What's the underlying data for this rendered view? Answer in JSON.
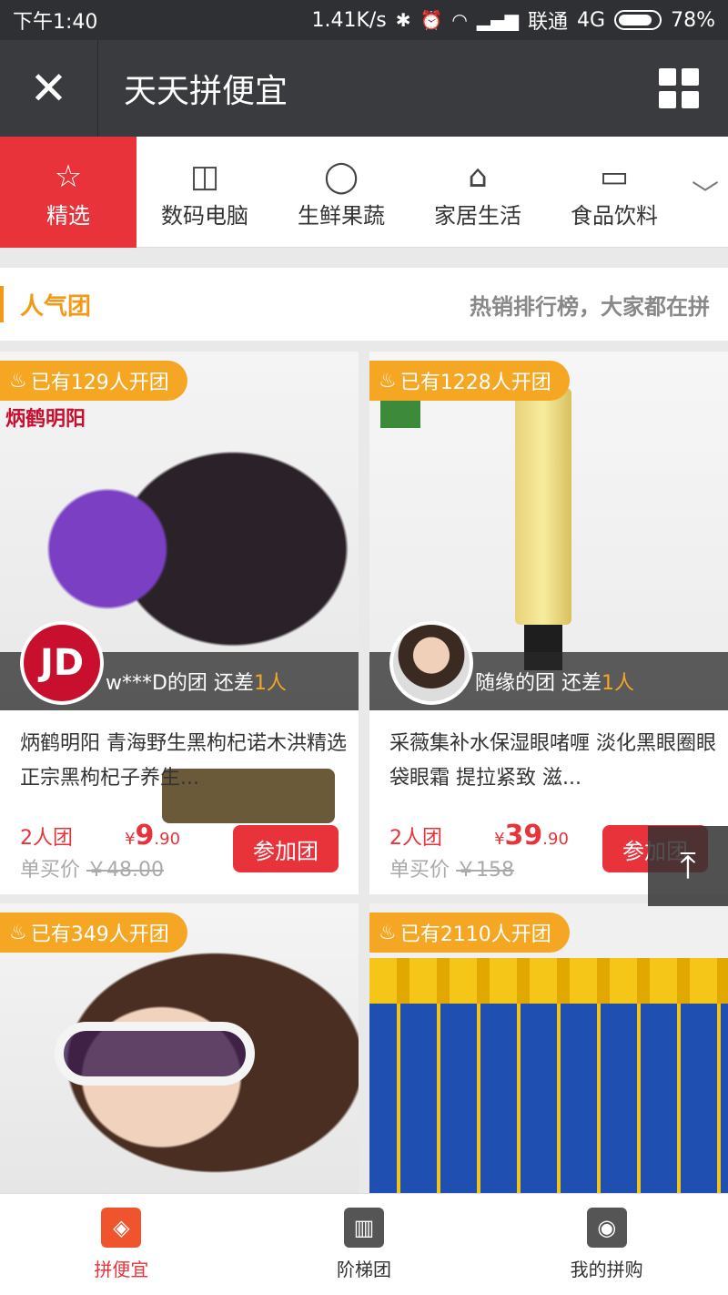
{
  "status": {
    "time": "下午1:40",
    "speed": "1.41K/s",
    "carrier": "联通",
    "network": "4G",
    "battery": "78%"
  },
  "nav": {
    "title": "天天拼便宜",
    "close_icon": "close-icon",
    "grid_icon": "grid-icon"
  },
  "categories": [
    {
      "label": "精选",
      "icon": "star-icon",
      "active": true
    },
    {
      "label": "数码电脑",
      "icon": "camera-icon"
    },
    {
      "label": "生鲜果蔬",
      "icon": "apple-icon"
    },
    {
      "label": "家居生活",
      "icon": "sofa-icon"
    },
    {
      "label": "食品饮料",
      "icon": "box-icon"
    }
  ],
  "section": {
    "title": "人气团",
    "subtitle": "热销排行榜，大家都在拼"
  },
  "products": [
    {
      "badge": "已有129人开团",
      "image_text": "炳鹤明阳",
      "avatar_text": "JD",
      "group_text": "w***D的团 还差",
      "need": "1人",
      "name": "炳鹤明阳 青海野生黑枸杞诺木洪精选正宗黑枸杞子养生...",
      "group_size": "2人团",
      "price_symbol": "¥",
      "price_int": "9",
      "price_dec": ".90",
      "solo_label": "单买价",
      "solo_price": "￥48.00",
      "join_label": "参加团"
    },
    {
      "badge": "已有1228人开团",
      "group_text": "随缘的团 还差",
      "need": "1人",
      "name": "采薇集补水保湿眼啫喱 淡化黑眼圈眼袋眼霜 提拉紧致 滋...",
      "group_size": "2人团",
      "price_symbol": "¥",
      "price_int": "39",
      "price_dec": ".90",
      "solo_label": "单买价",
      "solo_price": "￥158",
      "join_label": "参加团"
    },
    {
      "badge": "已有349人开团"
    },
    {
      "badge": "已有2110人开团"
    }
  ],
  "tabbar": [
    {
      "label": "拼便宜",
      "active": true
    },
    {
      "label": "阶梯团"
    },
    {
      "label": "我的拼购"
    }
  ]
}
